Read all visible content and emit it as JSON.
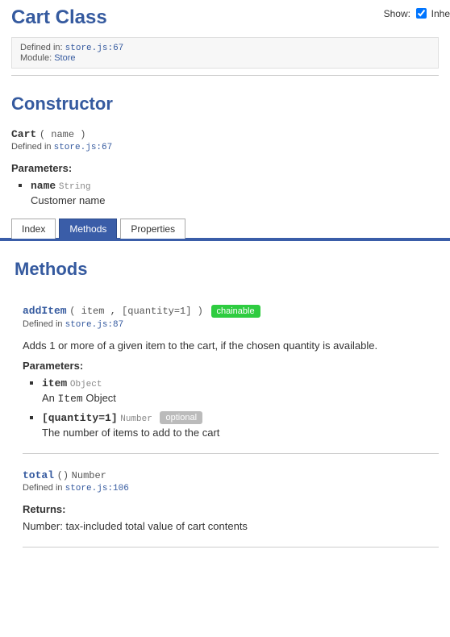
{
  "header": {
    "title": "Cart Class",
    "showLabel": "Show:",
    "showOption": "Inhe"
  },
  "meta": {
    "definedLabel": "Defined in:",
    "definedLink": "store.js:67",
    "moduleLabel": "Module:",
    "moduleLink": "Store"
  },
  "constructor": {
    "heading": "Constructor",
    "name": "Cart",
    "signature": "( name )",
    "definedLabel": "Defined in",
    "definedLink": "store.js:67",
    "parametersHead": "Parameters:",
    "param1Name": "name",
    "param1Type": "String",
    "param1Desc": "Customer name"
  },
  "tabs": {
    "index": "Index",
    "methods": "Methods",
    "properties": "Properties"
  },
  "methods": {
    "heading": "Methods",
    "addItem": {
      "name": "addItem",
      "signature": "( item , [quantity=1] )",
      "badge": "chainable",
      "definedLabel": "Defined in",
      "definedLink": "store.js:87",
      "desc": "Adds 1 or more of a given item to the cart, if the chosen quantity is available.",
      "parametersHead": "Parameters:",
      "p1Name": "item",
      "p1Type": "Object",
      "p1DescPrefix": "An ",
      "p1DescMono": "Item",
      "p1DescSuffix": " Object",
      "p2Name": "[quantity=1]",
      "p2Type": "Number",
      "p2Badge": "optional",
      "p2Desc": "The number of items to add to the cart"
    },
    "total": {
      "name": "total",
      "signature": "()",
      "returnType": "Number",
      "definedLabel": "Defined in",
      "definedLink": "store.js:106",
      "returnsHead": "Returns:",
      "returnsTypeLabel": "Number:",
      "returnsDesc": " tax-included total value of cart contents"
    }
  }
}
